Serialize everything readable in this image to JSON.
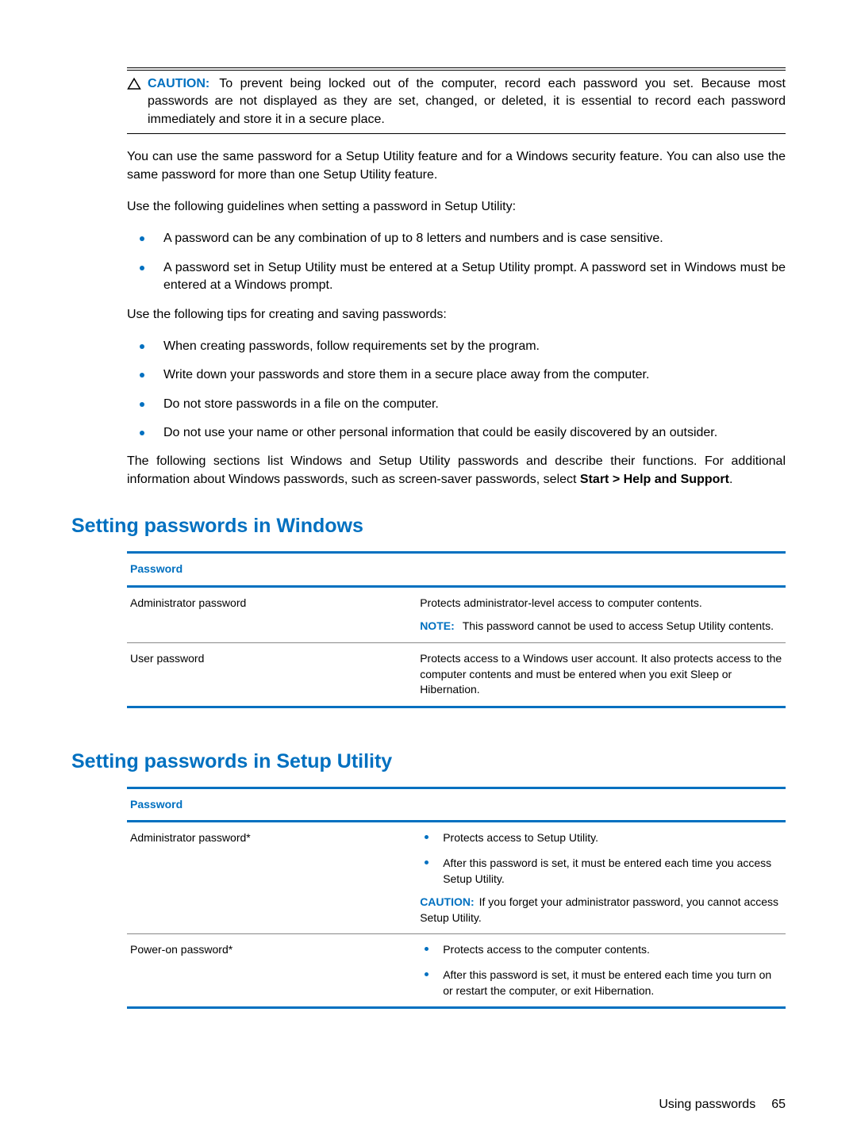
{
  "caution": {
    "label": "CAUTION:",
    "text": "To prevent being locked out of the computer, record each password you set. Because most passwords are not displayed as they are set, changed, or deleted, it is essential to record each password immediately and store it in a secure place."
  },
  "para1": "You can use the same password for a Setup Utility feature and for a Windows security feature. You can also use the same password for more than one Setup Utility feature.",
  "para2": "Use the following guidelines when setting a password in Setup Utility:",
  "guidelines": [
    "A password can be any combination of up to 8 letters and numbers and is case sensitive.",
    "A password set in Setup Utility must be entered at a Setup Utility prompt. A password set in Windows must be entered at a Windows prompt."
  ],
  "para3": "Use the following tips for creating and saving passwords:",
  "tips": [
    "When creating passwords, follow requirements set by the program.",
    "Write down your passwords and store them in a secure place away from the computer.",
    "Do not store passwords in a file on the computer.",
    "Do not use your name or other personal information that could be easily discovered by an outsider."
  ],
  "para4_a": "The following sections list Windows and Setup Utility passwords and describe their functions. For additional information about Windows passwords, such as screen-saver passwords, select ",
  "para4_b": "Start > Help and Support",
  "para4_c": ".",
  "section1": {
    "title": "Setting passwords in Windows",
    "header": "Password",
    "empty_header": " ",
    "row1": {
      "name": "Administrator password",
      "desc1": "Protects administrator-level access to computer contents.",
      "note_label": "NOTE:",
      "note_text": "This password cannot be used to access Setup Utility contents."
    },
    "row2": {
      "name": "User password",
      "desc": "Protects access to a Windows user account. It also protects access to the computer contents and must be entered when you exit Sleep or Hibernation."
    }
  },
  "section2": {
    "title": "Setting passwords in Setup Utility",
    "header": "Password",
    "empty_header": " ",
    "row1": {
      "name": "Administrator password*",
      "bullet1": "Protects access to Setup Utility.",
      "bullet2": "After this password is set, it must be entered each time you access Setup Utility.",
      "caution_label": "CAUTION:",
      "caution_text": "If you forget your administrator password, you cannot access Setup Utility."
    },
    "row2": {
      "name": "Power-on password*",
      "bullet1": "Protects access to the computer contents.",
      "bullet2": "After this password is set, it must be entered each time you turn on or restart the computer, or exit Hibernation."
    }
  },
  "footer": {
    "section": "Using passwords",
    "page": "65"
  }
}
